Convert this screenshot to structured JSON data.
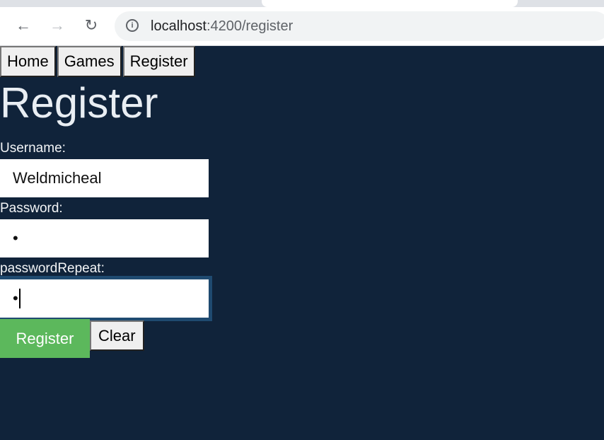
{
  "browser": {
    "url_host": "localhost",
    "url_path": ":4200/register",
    "icons": {
      "back": "back-arrow-icon",
      "forward": "forward-arrow-icon",
      "reload": "reload-icon",
      "info": "info-icon"
    }
  },
  "nav": {
    "items": [
      {
        "label": "Home"
      },
      {
        "label": "Games"
      },
      {
        "label": "Register"
      }
    ]
  },
  "page": {
    "title": "Register"
  },
  "form": {
    "username_label": "Username:",
    "username_value": "Weldmicheal",
    "password_label": "Password:",
    "password_value": "•",
    "password_repeat_label": "passwordRepeat:",
    "password_repeat_value": "•",
    "register_label": "Register",
    "clear_label": "Clear"
  },
  "colors": {
    "background": "#10233a",
    "register_button": "#5cb85c",
    "focus_outline": "#1f4a70"
  }
}
